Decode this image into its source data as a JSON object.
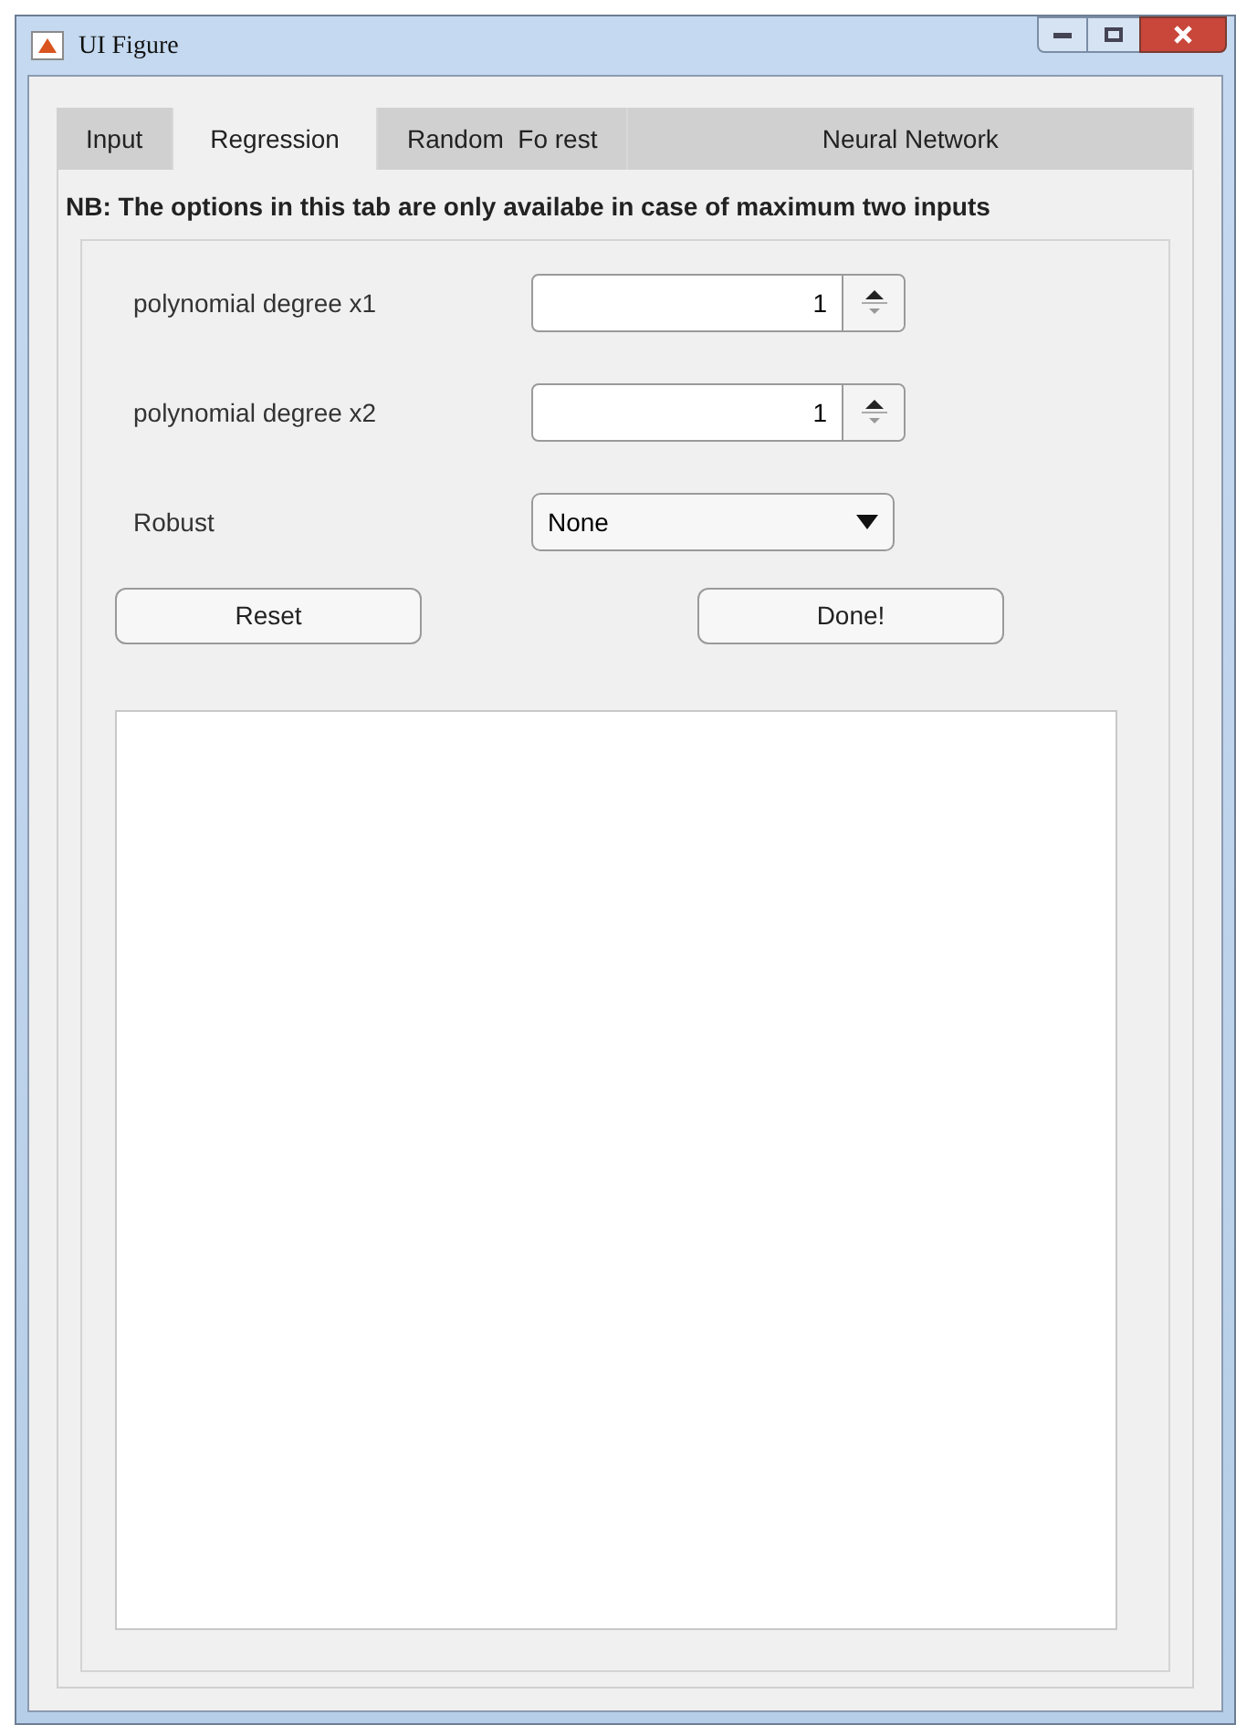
{
  "window": {
    "title": "UI Figure"
  },
  "tabs": [
    {
      "label": "Input",
      "selected": false
    },
    {
      "label": "Regression",
      "selected": true
    },
    {
      "label": "Random  Fo rest",
      "selected": false
    },
    {
      "label": "Neural Network",
      "selected": false
    }
  ],
  "note": "NB: The options in this tab are only availabe in case of maximum two inputs",
  "fields": [
    {
      "kind": "spinner",
      "label": "polynomial degree x1",
      "value": "1"
    },
    {
      "kind": "spinner",
      "label": "polynomial degree x2",
      "value": "1"
    },
    {
      "kind": "dropdown",
      "label": "Robust",
      "value": "None"
    }
  ],
  "buttons": [
    "Reset",
    "Done!"
  ]
}
